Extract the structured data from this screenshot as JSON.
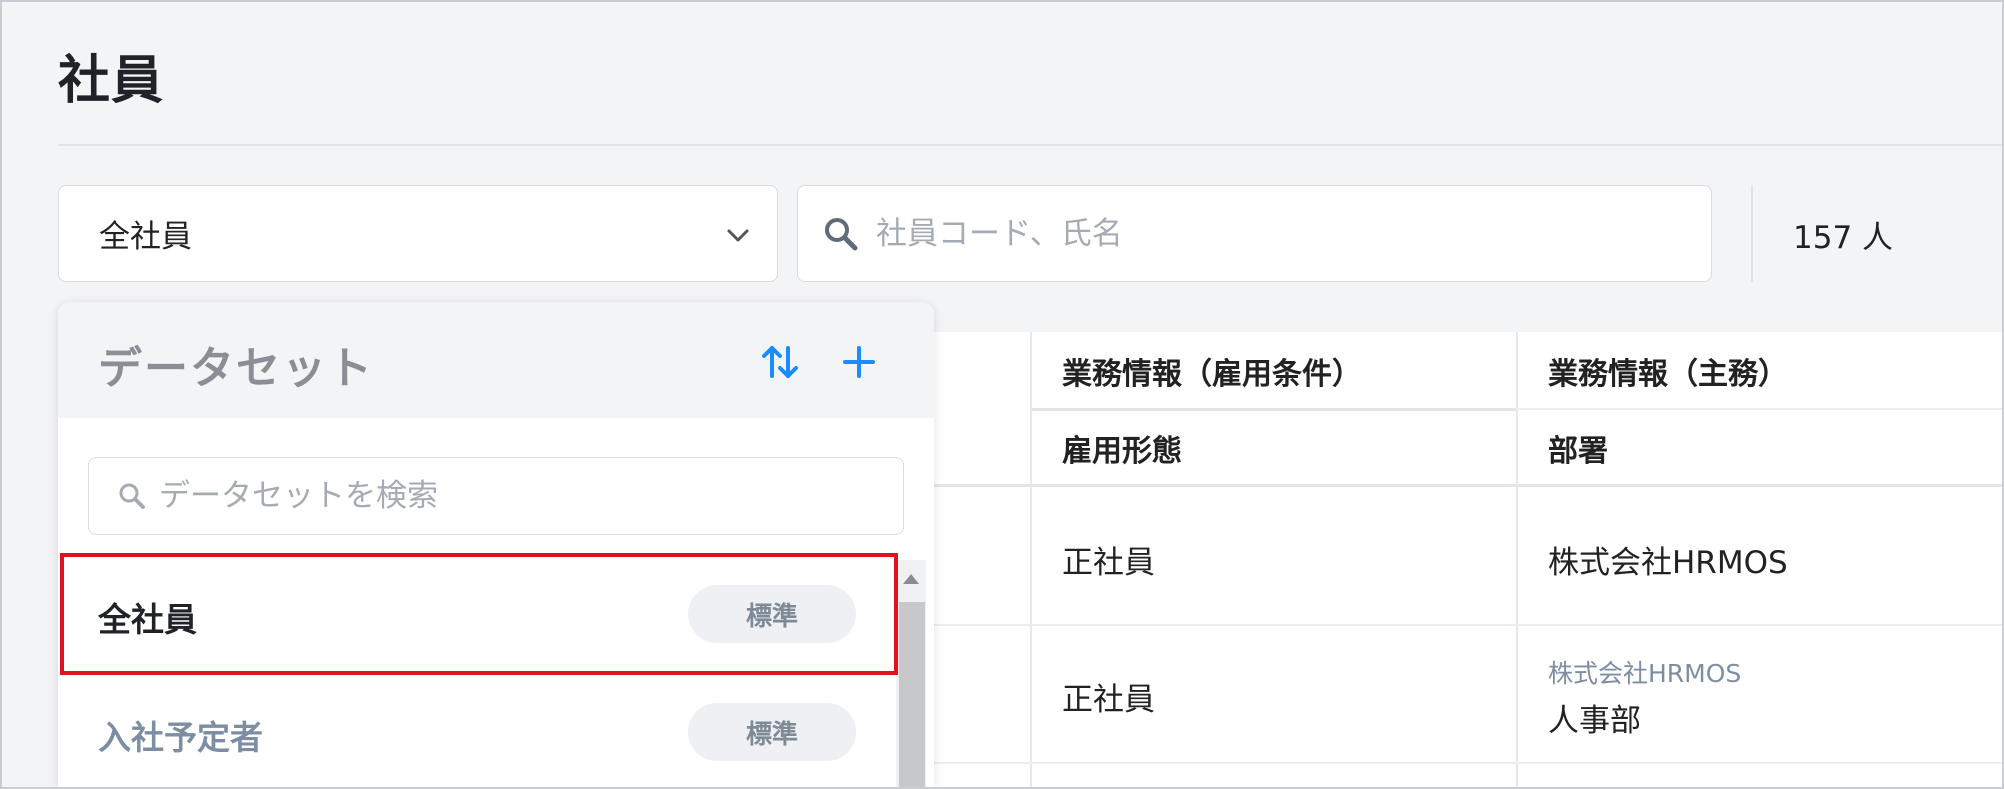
{
  "page": {
    "title": "社員"
  },
  "filter": {
    "dataset_value": "全社員",
    "search_placeholder": "社員コード、氏名",
    "count": "157 人"
  },
  "table": {
    "columns": [
      {
        "group": "業務情報（雇用条件）",
        "header": "雇用形態"
      },
      {
        "group": "業務情報（主務）",
        "header": "部署"
      }
    ],
    "rows": [
      {
        "employment_type": "正社員",
        "department": "株式会社HRMOS",
        "department_sub": ""
      },
      {
        "employment_type": "正社員",
        "department": "人事部",
        "department_sub": "株式会社HRMOS"
      }
    ]
  },
  "dataset_panel": {
    "title": "データセット",
    "search_placeholder": "データセットを検索",
    "items": [
      {
        "label": "全社員",
        "badge": "標準",
        "selected": true
      },
      {
        "label": "入社予定者",
        "badge": "標準",
        "selected": false
      }
    ]
  },
  "colors": {
    "accent": "#1a8cff",
    "highlight": "#e0121b"
  },
  "icons": {
    "sort": "sort-arrows-icon",
    "add": "plus-icon",
    "search": "search-icon",
    "dropdown": "chevron-down-icon"
  }
}
